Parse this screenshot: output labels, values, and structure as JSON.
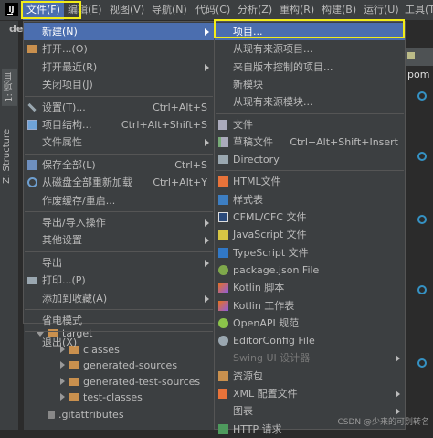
{
  "menubar": {
    "logo": "IJ",
    "items": [
      {
        "label": "文件(F)",
        "active": true
      },
      {
        "label": "编辑(E)"
      },
      {
        "label": "视图(V)"
      },
      {
        "label": "导航(N)"
      },
      {
        "label": "代码(C)"
      },
      {
        "label": "分析(Z)"
      },
      {
        "label": "重构(R)"
      },
      {
        "label": "构建(B)"
      },
      {
        "label": "运行(U)"
      },
      {
        "label": "工具(T)"
      }
    ]
  },
  "background": {
    "project_stub": "de",
    "left_tabs": [
      "1: 项目",
      "Z: Structure"
    ],
    "editor_tab": "pom"
  },
  "file_menu": [
    {
      "label": "新建(N)",
      "submenu": true,
      "selected": true
    },
    {
      "label": "打开...(O)",
      "icon": "folder-open-icon"
    },
    {
      "label": "打开最近(R)",
      "submenu": true
    },
    {
      "label": "关闭项目(J)"
    },
    {
      "separator": true
    },
    {
      "label": "设置(T)...",
      "shortcut": "Ctrl+Alt+S",
      "icon": "wrench-icon"
    },
    {
      "label": "项目结构...",
      "shortcut": "Ctrl+Alt+Shift+S",
      "icon": "project-structure-icon"
    },
    {
      "label": "文件属性",
      "submenu": true
    },
    {
      "separator": true
    },
    {
      "label": "保存全部(L)",
      "shortcut": "Ctrl+S",
      "icon": "save-all-icon"
    },
    {
      "label": "从磁盘全部重新加载",
      "shortcut": "Ctrl+Alt+Y",
      "icon": "reload-icon"
    },
    {
      "label": "作废缓存/重启..."
    },
    {
      "separator": true
    },
    {
      "label": "导出/导入操作",
      "submenu": true
    },
    {
      "label": "其他设置",
      "submenu": true
    },
    {
      "separator": true
    },
    {
      "label": "导出",
      "submenu": true
    },
    {
      "label": "打印...(P)",
      "icon": "print-icon"
    },
    {
      "label": "添加到收藏(A)",
      "submenu": true
    },
    {
      "separator": true
    },
    {
      "label": "省电模式"
    },
    {
      "separator": true
    },
    {
      "label": "退出(X)"
    }
  ],
  "new_submenu": [
    {
      "label": "项目...",
      "selected": true
    },
    {
      "label": "从现有来源项目..."
    },
    {
      "label": "来自版本控制的项目..."
    },
    {
      "label": "新模块"
    },
    {
      "label": "从现有来源模块..."
    },
    {
      "separator": true
    },
    {
      "label": "文件",
      "icon": "file-icon"
    },
    {
      "label": "草稿文件",
      "shortcut": "Ctrl+Alt+Shift+Insert",
      "icon": "scratch-file-icon"
    },
    {
      "label": "Directory",
      "icon": "directory-icon"
    },
    {
      "separator": true
    },
    {
      "label": "HTML文件",
      "icon": "html-file-icon"
    },
    {
      "label": "样式表",
      "icon": "stylesheet-icon"
    },
    {
      "label": "CFML/CFC 文件",
      "icon": "cfml-icon"
    },
    {
      "label": "JavaScript 文件",
      "icon": "javascript-icon"
    },
    {
      "label": "TypeScript 文件",
      "icon": "typescript-icon"
    },
    {
      "label": "package.json File",
      "icon": "package-json-icon"
    },
    {
      "label": "Kotlin 脚本",
      "icon": "kotlin-script-icon"
    },
    {
      "label": "Kotlin 工作表",
      "icon": "kotlin-worksheet-icon"
    },
    {
      "label": "OpenAPI 规范",
      "icon": "openapi-icon"
    },
    {
      "label": "EditorConfig File",
      "icon": "editorconfig-icon"
    },
    {
      "label": "Swing UI 设计器",
      "disabled": true,
      "submenu": true
    },
    {
      "label": "资源包",
      "icon": "resource-bundle-icon"
    },
    {
      "label": "XML 配置文件",
      "submenu": true,
      "icon": "xml-icon"
    },
    {
      "label": "图表",
      "submenu": true
    },
    {
      "label": "HTTP 请求",
      "icon": "http-request-icon"
    }
  ],
  "tree": [
    {
      "label": "target",
      "indent": 0,
      "expanded": true
    },
    {
      "label": "classes",
      "indent": 1
    },
    {
      "label": "generated-sources",
      "indent": 1
    },
    {
      "label": "generated-test-sources",
      "indent": 1
    },
    {
      "label": "test-classes",
      "indent": 1
    },
    {
      "label": ".gitattributes",
      "indent": 0,
      "file": true
    }
  ],
  "watermark": "CSDN @少来的可别转名",
  "colors": {
    "selection": "#4b6eaf",
    "highlight": "#f2ec18",
    "menu_bg": "#3c3f41"
  }
}
